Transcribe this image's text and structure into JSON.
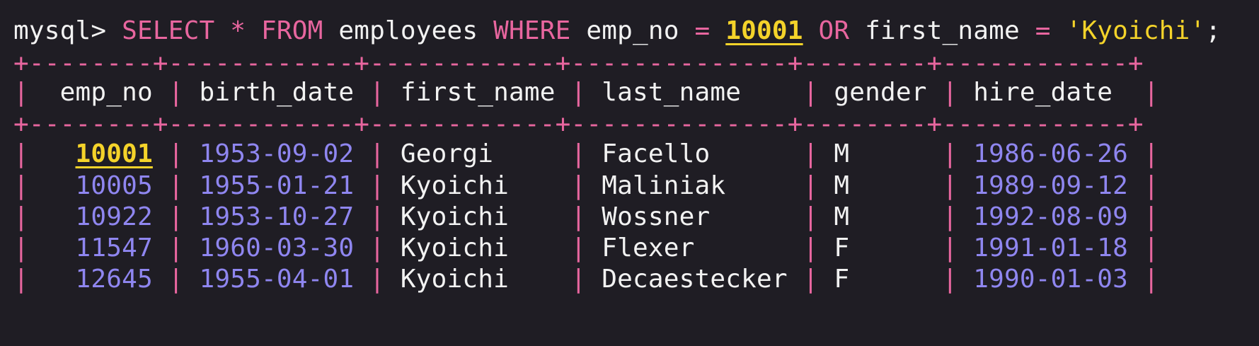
{
  "terminal": {
    "prompt": "mysql> ",
    "query": {
      "kw_select": "SELECT",
      "star": "*",
      "kw_from": "FROM",
      "table": "employees",
      "kw_where": "WHERE",
      "col1": "emp_no",
      "eq1": "=",
      "val1": "10001",
      "kw_or": "OR",
      "col2": "first_name",
      "eq2": "=",
      "val2": "'Kyoichi'",
      "terminator": ";"
    }
  },
  "result": {
    "border": "+--------+------------+------------+--------------+--------+------------+",
    "columns": [
      "emp_no",
      "birth_date",
      "first_name",
      "last_name",
      "gender",
      "hire_date"
    ],
    "rows": [
      {
        "emp_no": "10001",
        "birth_date": "1953-09-02",
        "first_name": "Georgi",
        "last_name": "Facello",
        "gender": "M",
        "hire_date": "1986-06-26",
        "highlight": true
      },
      {
        "emp_no": "10005",
        "birth_date": "1955-01-21",
        "first_name": "Kyoichi",
        "last_name": "Maliniak",
        "gender": "M",
        "hire_date": "1989-09-12",
        "highlight": false
      },
      {
        "emp_no": "10922",
        "birth_date": "1953-10-27",
        "first_name": "Kyoichi",
        "last_name": "Wossner",
        "gender": "M",
        "hire_date": "1992-08-09",
        "highlight": false
      },
      {
        "emp_no": "11547",
        "birth_date": "1960-03-30",
        "first_name": "Kyoichi",
        "last_name": "Flexer",
        "gender": "F",
        "hire_date": "1991-01-18",
        "highlight": false
      },
      {
        "emp_no": "12645",
        "birth_date": "1955-04-01",
        "first_name": "Kyoichi",
        "last_name": "Decaestecker",
        "gender": "F",
        "hire_date": "1990-01-03",
        "highlight": false
      }
    ]
  },
  "colors": {
    "background": "#1f1d24",
    "keyword": "#e8669f",
    "text": "#f2f2f2",
    "highlight": "#f4d32a",
    "number": "#8f86f0"
  }
}
